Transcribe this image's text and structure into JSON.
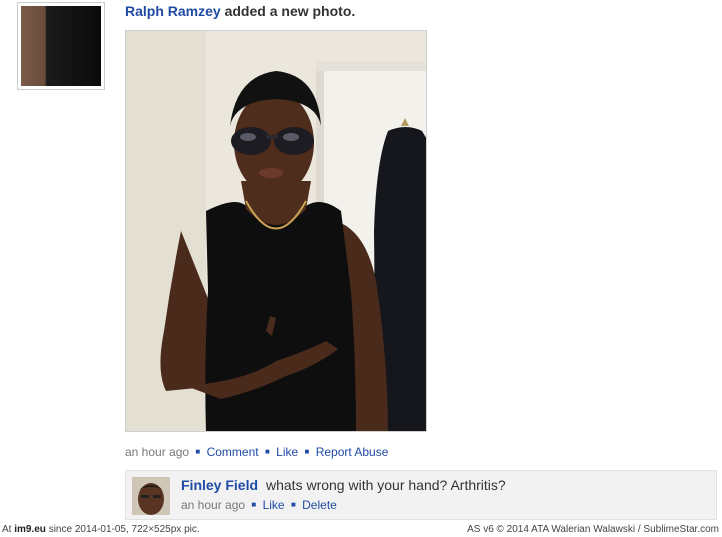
{
  "post": {
    "actor_name": "Ralph Ramzey",
    "action_text": " added a new photo.",
    "timestamp": "an hour ago",
    "actions": [
      "Comment",
      "Like",
      "Report Abuse"
    ]
  },
  "comment": {
    "author": "Finley Field",
    "text": "whats wrong with your hand? Arthritis?",
    "timestamp": "an hour ago",
    "actions": [
      "Like",
      "Delete"
    ]
  },
  "footer": {
    "left_prefix": "At ",
    "site": "im9.eu",
    "left_suffix": "  since 2014-01-05, 722×525px pic.",
    "right": "AS v6 © 2014 ATA Walerian Walawski / SublimeStar.com"
  }
}
